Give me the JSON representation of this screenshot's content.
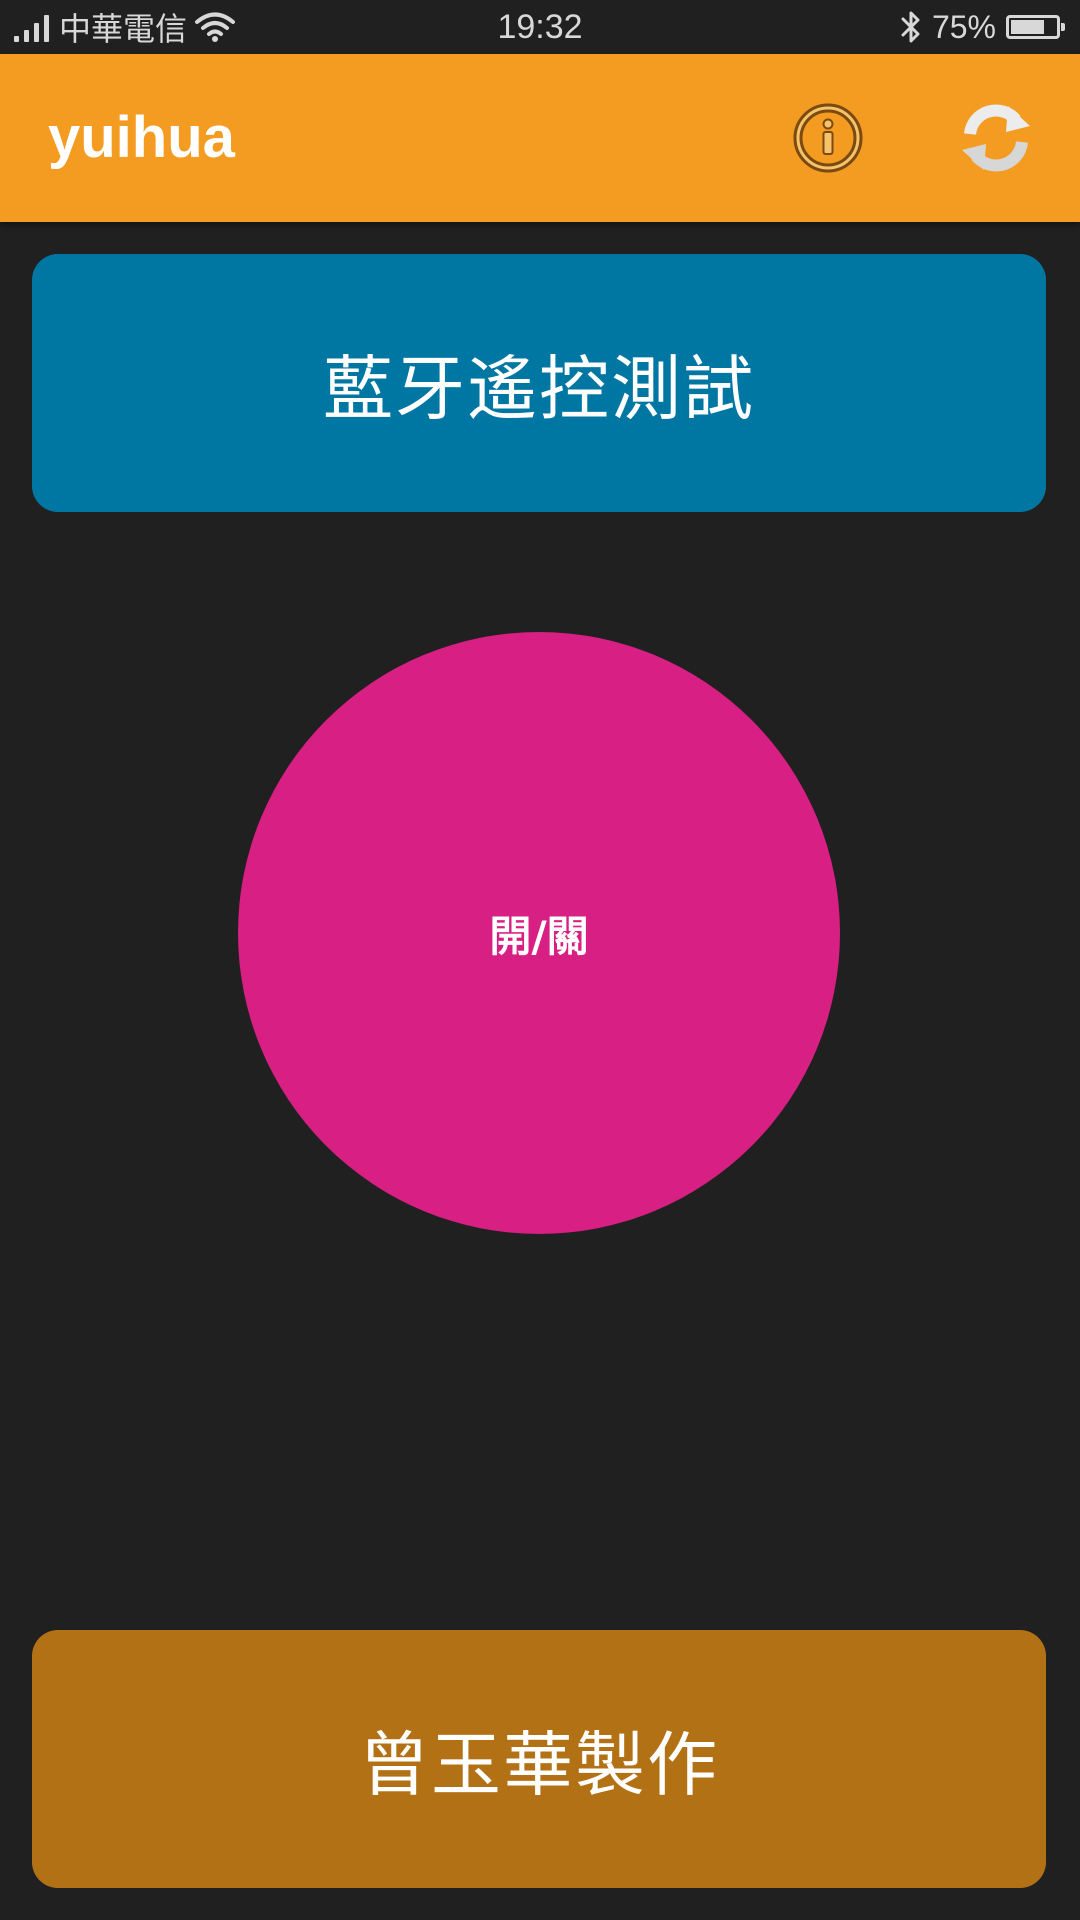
{
  "status_bar": {
    "carrier": "中華電信",
    "time": "19:32",
    "battery_percent_text": "75%",
    "battery_level": 0.75,
    "icons": [
      "signal-icon",
      "wifi-icon",
      "bluetooth-icon",
      "battery-icon"
    ]
  },
  "app_bar": {
    "title": "yuihua",
    "background_color": "#f39c21",
    "actions": [
      "info-icon",
      "refresh-icon"
    ]
  },
  "main": {
    "test_button_label": "藍牙遙控測試",
    "test_button_color": "#0077a3",
    "power_button_label": "開/關",
    "power_button_color": "#d81f83",
    "credit_button_label": "曾玉華製作",
    "credit_button_color": "#b37116"
  }
}
